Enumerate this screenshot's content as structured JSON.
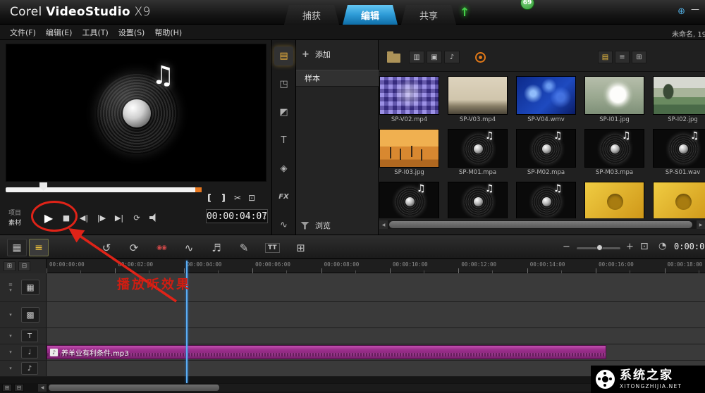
{
  "titlebar": {
    "brand": {
      "corel": "Corel",
      "product": "VideoStudio",
      "version": "X9"
    },
    "tabs": [
      {
        "label": "捕获",
        "cls": ""
      },
      {
        "label": "编辑",
        "cls": "active"
      },
      {
        "label": "共享",
        "cls": ""
      }
    ],
    "update_badge": "69",
    "minimize": "—"
  },
  "menubar": {
    "items": [
      "文件(F)",
      "编辑(E)",
      "工具(T)",
      "设置(S)",
      "帮助(H)"
    ],
    "project_name": "未命名, 19"
  },
  "preview": {
    "mode_project": "项目",
    "mode_clip": "素材",
    "timecode": "00:00:04:07"
  },
  "nav_rail": [
    {
      "glyph": "▤",
      "cls": "active",
      "name": "media-library"
    },
    {
      "glyph": "◳",
      "cls": "",
      "name": "instant-project"
    },
    {
      "glyph": "◩",
      "cls": "",
      "name": "transition"
    },
    {
      "glyph": "T",
      "cls": "",
      "name": "title"
    },
    {
      "glyph": "◈",
      "cls": "",
      "name": "graphic"
    },
    {
      "glyph": "FX",
      "cls": "fx",
      "name": "filter"
    },
    {
      "glyph": "∿",
      "cls": "",
      "name": "motion-path"
    }
  ],
  "library": {
    "add_label": "添加",
    "folder": "样本",
    "browse_label": "浏览",
    "filters": [
      "▥",
      "▣",
      "♪"
    ],
    "views": [
      {
        "glyph": "▤",
        "cls": "active"
      },
      {
        "glyph": "≡",
        "cls": ""
      },
      {
        "glyph": "⊞",
        "cls": ""
      }
    ],
    "items": [
      {
        "name": "SP-V02.mp4",
        "kind": "v02"
      },
      {
        "name": "SP-V03.mp4",
        "kind": "v03"
      },
      {
        "name": "SP-V04.wmv",
        "kind": "v04"
      },
      {
        "name": "SP-I01.jpg",
        "kind": "i01"
      },
      {
        "name": "SP-I02.jpg",
        "kind": "i02"
      },
      {
        "name": "SP-I03.jpg",
        "kind": "i03"
      },
      {
        "name": "SP-M01.mpa",
        "kind": "audio"
      },
      {
        "name": "SP-M02.mpa",
        "kind": "audio"
      },
      {
        "name": "SP-M03.mpa",
        "kind": "audio"
      },
      {
        "name": "SP-S01.wav",
        "kind": "audio"
      },
      {
        "name": "",
        "kind": "audio"
      },
      {
        "name": "",
        "kind": "audio"
      },
      {
        "name": "",
        "kind": "audio"
      },
      {
        "name": "",
        "kind": "swf"
      },
      {
        "name": "",
        "kind": "swf"
      }
    ]
  },
  "toolbar": {
    "view_storyboard": "▦",
    "view_timeline": "≡",
    "tools": [
      {
        "glyph": "↺",
        "cls": "",
        "name": "undo"
      },
      {
        "glyph": "⟳",
        "cls": "",
        "name": "redo"
      },
      {
        "glyph": "◉◉",
        "cls": "red",
        "name": "record-capture-option"
      },
      {
        "glyph": "∿",
        "cls": "",
        "name": "sound-mixer"
      },
      {
        "glyph": "♬",
        "cls": "",
        "name": "auto-music"
      },
      {
        "glyph": "✎",
        "cls": "",
        "name": "painting-creator"
      },
      {
        "glyph": "TT",
        "cls": "small",
        "name": "subtitle-editor"
      },
      {
        "glyph": "⊞",
        "cls": "",
        "name": "multicam-editor"
      }
    ],
    "zoom_out": "−",
    "zoom_in": "+",
    "fit": "⊡",
    "clock": "◔",
    "timecode": "0:00:0"
  },
  "timeline": {
    "ruler": [
      "00:00:00:00",
      "00:00:02:00",
      "00:00:04:00",
      "00:00:06:00",
      "00:00:08:00",
      "00:00:10:00",
      "00:00:12:00",
      "00:00:14:00",
      "00:00:16:00",
      "00:00:18:00"
    ],
    "track_icons": {
      "video": "▦",
      "overlay": "▩",
      "title": "T",
      "voice": "♩",
      "music": "♪"
    },
    "clip_name": "养羊业有利条件.mp3",
    "clip_icon": "♪"
  },
  "annotation": {
    "text": "播放听效果"
  },
  "watermark": {
    "name": "系统之家",
    "site": "XITONGZHIJIA.NET"
  },
  "colors": {
    "accent_blue": "#2d9ad6",
    "highlight_yellow": "#f0c33c",
    "annotation_red": "#df2318",
    "clip_magenta": "#9c2f8c",
    "badge_green": "#2f9a33"
  },
  "icons": {
    "play": "▶",
    "stop": "■",
    "prev_frame": "◀|",
    "next_frame": "|▶",
    "jump_end": "▶|",
    "repeat": "⟳",
    "mark_in": "[",
    "mark_out": "]",
    "split": "✂",
    "enlarge": "⊡",
    "spin_up": "▲",
    "spin_down": "▼",
    "music_note": "♫",
    "up_arrow": "↑",
    "globe": "⊕",
    "plus": "+",
    "track_plus": "⊞",
    "track_minus": "⊟",
    "menu": "≡",
    "chevron": "▾",
    "scroll_left": "◀",
    "scroll_right": "▶"
  }
}
